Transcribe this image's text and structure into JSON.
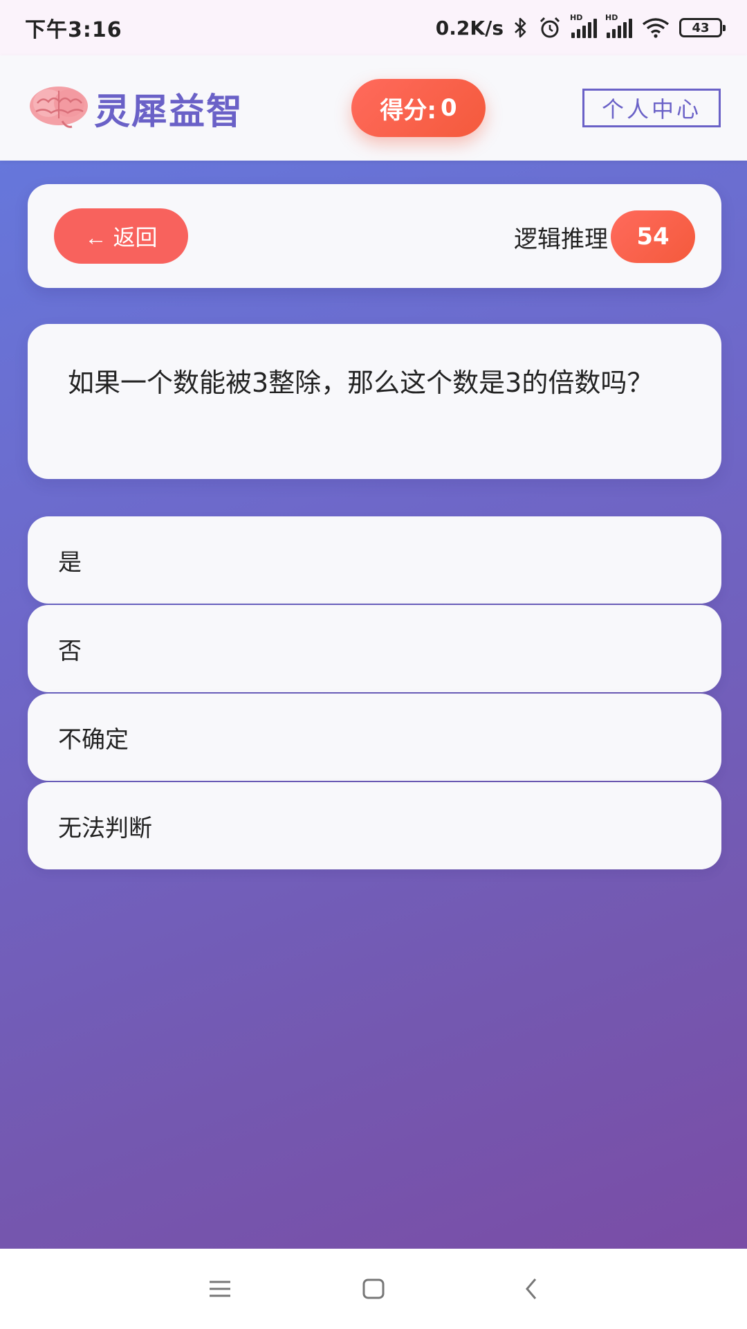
{
  "status_bar": {
    "time": "下午3:16",
    "network_speed": "0.2K/s",
    "battery": "43",
    "icons": [
      "bluetooth-icon",
      "alarm-icon",
      "signal-hd-icon",
      "signal-hd-icon",
      "wifi-icon",
      "battery-icon"
    ]
  },
  "header": {
    "brand_name": "灵犀益智",
    "score_label": "得分:",
    "score_value": "0",
    "profile_label": "个人中心",
    "logo_icon": "brain-icon"
  },
  "nav": {
    "back_label": "← 返回",
    "category": "逻辑推理",
    "question_count": "54"
  },
  "question": {
    "text": "如果一个数能被3整除，那么这个数是3的倍数吗？"
  },
  "options": [
    "是",
    "否",
    "不确定",
    "无法判断"
  ],
  "bottom_nav": {
    "icons": [
      "menu-icon",
      "home-icon",
      "back-icon"
    ]
  },
  "colors": {
    "accent": "#6a61c7",
    "score_orange": "#f45a3c",
    "back_red": "#f8625d",
    "gradient_start": "#6677db",
    "gradient_end": "#7a4da6"
  }
}
